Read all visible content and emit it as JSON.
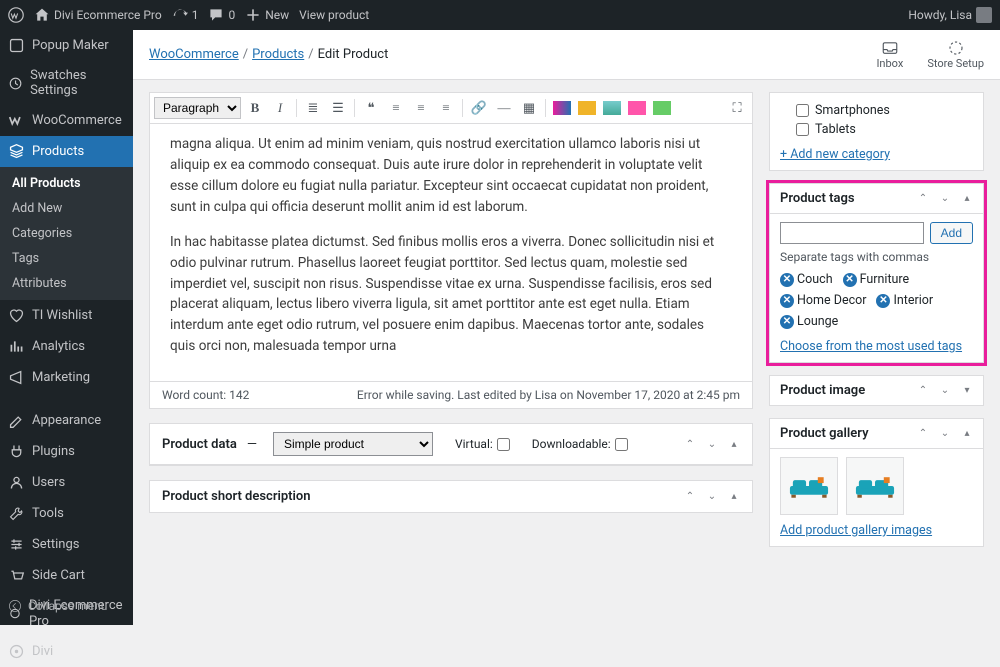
{
  "adminbar": {
    "site_title": "Divi Ecommerce Pro",
    "refresh_count": "1",
    "comments_count": "0",
    "new_label": "New",
    "view_product": "View product",
    "howdy": "Howdy, Lisa"
  },
  "sidebar": {
    "items": [
      {
        "label": "Popup Maker"
      },
      {
        "label": "Swatches Settings"
      },
      {
        "label": "WooCommerce"
      },
      {
        "label": "Products"
      },
      {
        "label": "TI Wishlist"
      },
      {
        "label": "Analytics"
      },
      {
        "label": "Marketing"
      },
      {
        "label": "Appearance"
      },
      {
        "label": "Plugins"
      },
      {
        "label": "Users"
      },
      {
        "label": "Tools"
      },
      {
        "label": "Settings"
      },
      {
        "label": "Side Cart"
      },
      {
        "label": "Divi Ecommerce Pro"
      },
      {
        "label": "Divi"
      }
    ],
    "submenu_products": [
      {
        "label": "All Products"
      },
      {
        "label": "Add New"
      },
      {
        "label": "Categories"
      },
      {
        "label": "Tags"
      },
      {
        "label": "Attributes"
      }
    ],
    "collapse": "Collapse menu"
  },
  "topstrip": {
    "breadcrumb": {
      "woo": "WooCommerce",
      "products": "Products",
      "edit": "Edit Product"
    },
    "inbox": "Inbox",
    "store_setup": "Store Setup"
  },
  "editor": {
    "format_select": "Paragraph",
    "body_p1": "magna aliqua. Ut enim ad minim veniam, quis nostrud exercitation ullamco laboris nisi ut aliquip ex ea commodo consequat. Duis aute irure dolor in reprehenderit in voluptate velit esse cillum dolore eu fugiat nulla pariatur. Excepteur sint occaecat cupidatat non proident, sunt in culpa qui officia deserunt mollit anim id est laborum.",
    "body_p2": "In hac habitasse platea dictumst. Sed finibus mollis eros a viverra. Donec sollicitudin nisi et odio pulvinar rutrum. Phasellus laoreet feugiat porttitor. Sed lectus quam, molestie sed imperdiet vel, suscipit non risus. Suspendisse vitae ex urna. Suspendisse facilisis, eros sed placerat aliquam, lectus libero viverra ligula, sit amet porttitor ante est eget nulla. Etiam interdum ante eget odio rutrum, vel posuere enim dapibus. Maecenas tortor ante, sodales quis orci non, malesuada tempor urna",
    "word_count_label": "Word count: 142",
    "save_status": "Error while saving. Last edited by Lisa on November 17, 2020 at 2:45 pm"
  },
  "product_data": {
    "title": "Product data",
    "dash": "—",
    "select": "Simple product",
    "virtual": "Virtual:",
    "downloadable": "Downloadable:"
  },
  "short_desc": {
    "title": "Product short description"
  },
  "categories": {
    "items": [
      "Smartphones",
      "Tablets"
    ],
    "add_new": "+ Add new category"
  },
  "tags_box": {
    "title": "Product tags",
    "add_btn": "Add",
    "hint": "Separate tags with commas",
    "tags": [
      "Couch",
      "Furniture",
      "Home Decor",
      "Interior",
      "Lounge"
    ],
    "choose": "Choose from the most used tags"
  },
  "image_box": {
    "title": "Product image"
  },
  "gallery_box": {
    "title": "Product gallery",
    "add": "Add product gallery images"
  }
}
